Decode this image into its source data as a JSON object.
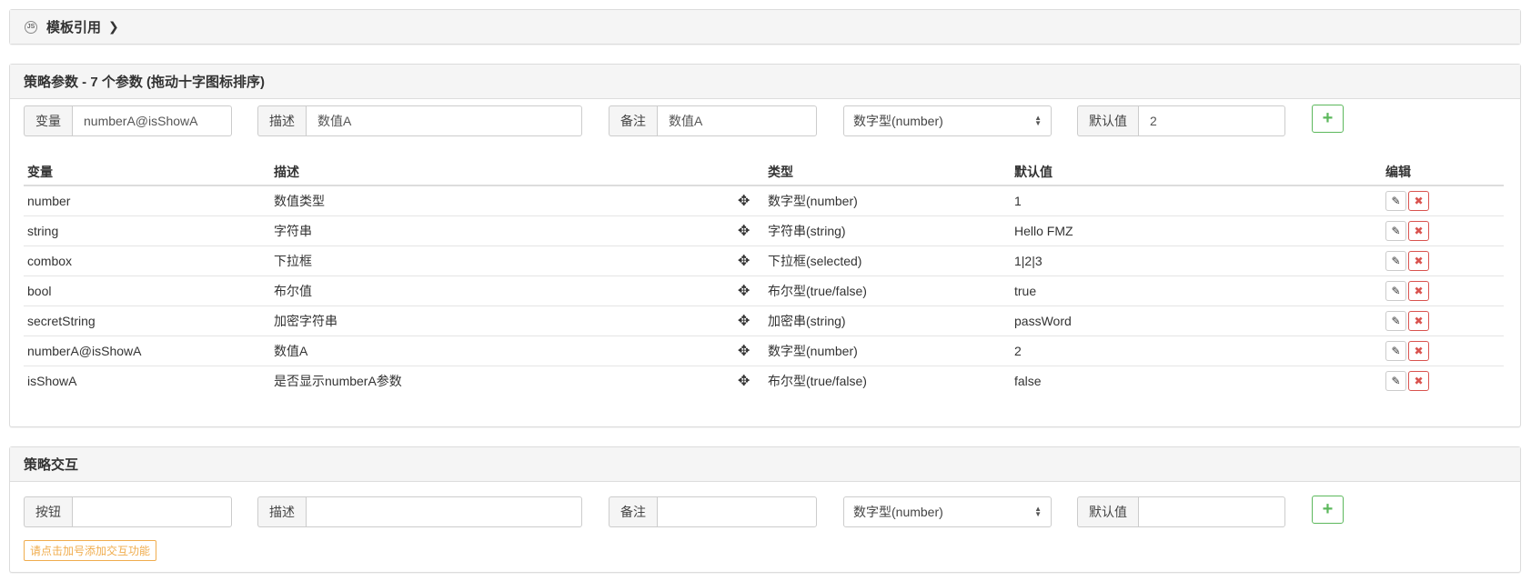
{
  "template_ref": {
    "title": "模板引用",
    "icon": "js-icon",
    "chevron": "❯",
    "js_text": "JS"
  },
  "params": {
    "title": "策略参数 - 7 个参数 (拖动十字图标排序)",
    "form": {
      "var_label": "变量",
      "var_value": "numberA@isShowA",
      "desc_label": "描述",
      "desc_value": "数值A",
      "note_label": "备注",
      "note_value": "数值A",
      "type_value": "数字型(number)",
      "default_label": "默认值",
      "default_value": "2",
      "add_label": "+"
    },
    "columns": [
      "变量",
      "描述",
      "类型",
      "默认值",
      "编辑"
    ],
    "rows": [
      {
        "var": "number",
        "desc": "数值类型",
        "type": "数字型(number)",
        "default": "1"
      },
      {
        "var": "string",
        "desc": "字符串",
        "type": "字符串(string)",
        "default": "Hello FMZ"
      },
      {
        "var": "combox",
        "desc": "下拉框",
        "type": "下拉框(selected)",
        "default": "1|2|3"
      },
      {
        "var": "bool",
        "desc": "布尔值",
        "type": "布尔型(true/false)",
        "default": "true"
      },
      {
        "var": "secretString",
        "desc": "加密字符串",
        "type": "加密串(string)",
        "default": "passWord"
      },
      {
        "var": "numberA@isShowA",
        "desc": "数值A",
        "type": "数字型(number)",
        "default": "2"
      },
      {
        "var": "isShowA",
        "desc": "是否显示numberA参数",
        "type": "布尔型(true/false)",
        "default": "false"
      }
    ],
    "move_glyph": "✥",
    "edit_glyph": "✎",
    "delete_glyph": "✖"
  },
  "interact": {
    "title": "策略交互",
    "form": {
      "button_label": "按钮",
      "button_value": "",
      "desc_label": "描述",
      "desc_value": "",
      "note_label": "备注",
      "note_value": "",
      "type_value": "数字型(number)",
      "default_label": "默认值",
      "default_value": "",
      "add_label": "+"
    },
    "hint": "请点击加号添加交互功能"
  },
  "colors": {
    "add_green": "#5cb85c",
    "delete_red": "#d9534f",
    "hint_orange": "#f0ad4e"
  }
}
